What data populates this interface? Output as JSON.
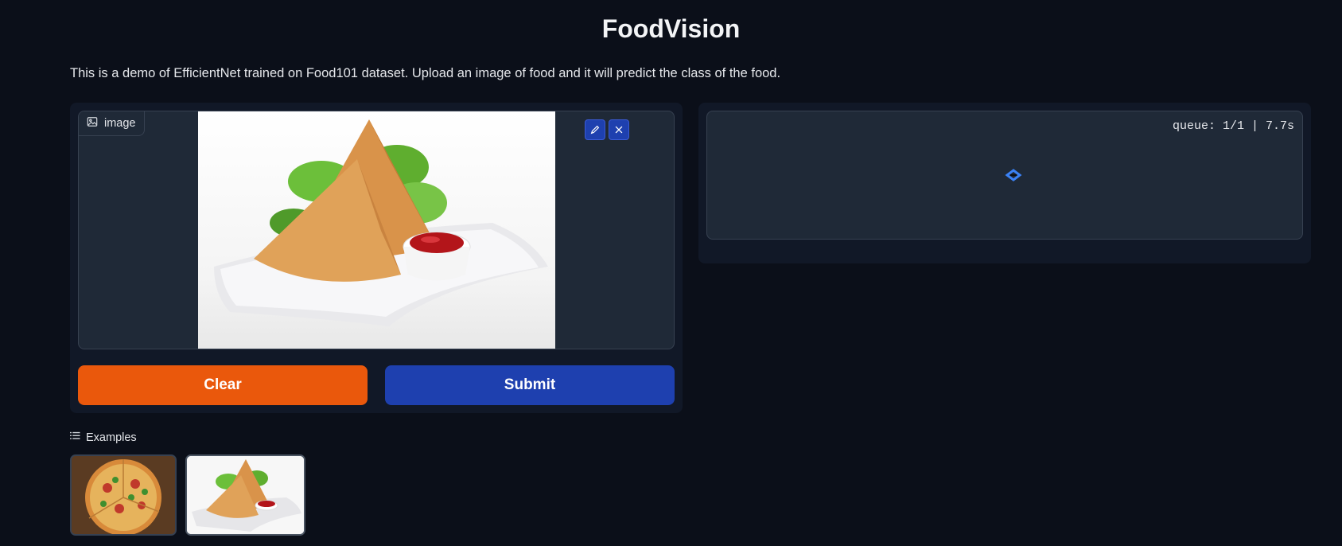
{
  "header": {
    "title": "FoodVision",
    "description": "This is a demo of EfficientNet trained on Food101 dataset. Upload an image of food and it will predict the class of the food."
  },
  "input": {
    "image_label": "image",
    "icons": [
      "image-icon",
      "edit-icon",
      "close-icon"
    ]
  },
  "buttons": {
    "clear_label": "Clear",
    "submit_label": "Submit"
  },
  "output": {
    "queue_status": "queue: 1/1 | 7.7s"
  },
  "examples": {
    "label": "Examples",
    "items": [
      "pizza",
      "samosa"
    ]
  },
  "colors": {
    "background": "#0b0f19",
    "panel": "#111827",
    "clear_button": "#ea580c",
    "submit_button": "#1e40af",
    "accent": "#3b82f6"
  }
}
